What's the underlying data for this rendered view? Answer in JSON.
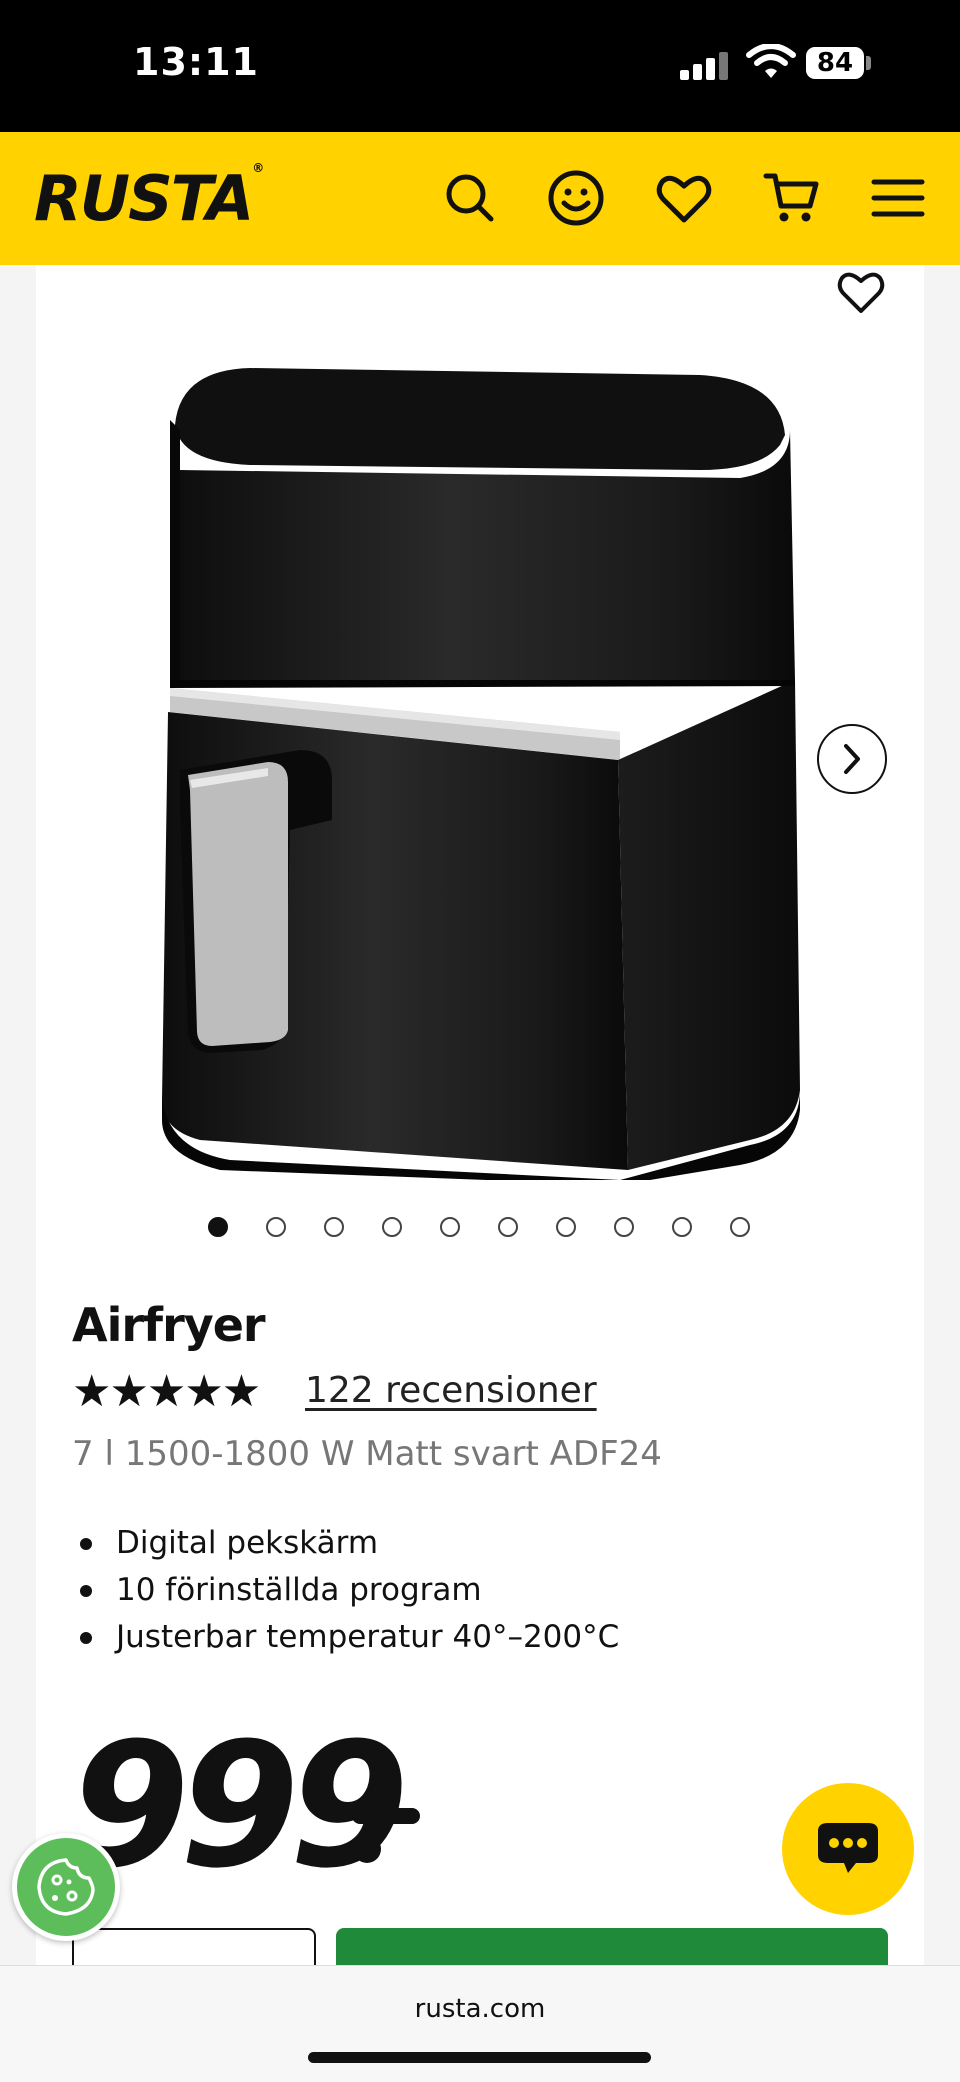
{
  "status_bar": {
    "time": "13:11",
    "battery": "84"
  },
  "header": {
    "logo": "RUSTA",
    "logo_mark": "®",
    "icons": [
      "search-icon",
      "account-icon",
      "heart-icon",
      "cart-icon",
      "menu-icon"
    ]
  },
  "gallery": {
    "image_count": 10,
    "active_index": 0
  },
  "product": {
    "title": "Airfryer",
    "rating_stars": "★★★★★",
    "rating": 5,
    "reviews_label": "122 recensioner",
    "subtitle": "7 l 1500-1800 W Matt svart ADF24",
    "features": [
      "Digital pekskärm",
      "10 förinställda program",
      "Justerbar temperatur 40°–200°C"
    ],
    "price": "999"
  },
  "browser": {
    "url": "rusta.com"
  },
  "colors": {
    "brand_yellow": "#ffd200",
    "buy_green": "#1e8a3a",
    "cookie_green": "#5cbd5a"
  }
}
